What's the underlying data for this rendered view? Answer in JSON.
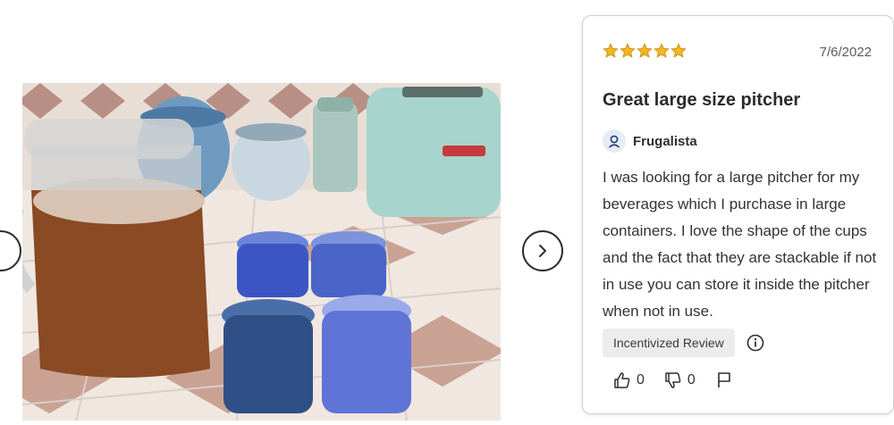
{
  "review": {
    "rating": 5,
    "date": "7/6/2022",
    "title": "Great large size pitcher",
    "author": "Frugalista",
    "body": "I was looking for a large pitcher for my beverages which I purchase in large containers. I love the shape of the cups and the fact that they are stackable if not in use you can store it inside the pitcher when not in use.",
    "badge": "Incentivized Review",
    "helpful_count": "0",
    "not_helpful_count": "0"
  },
  "icons": {
    "prev": "chevron-left-icon",
    "next": "chevron-right-icon",
    "star": "star-icon",
    "avatar": "user-icon",
    "info": "info-icon",
    "thumbs_up": "thumbs-up-icon",
    "thumbs_down": "thumbs-down-icon",
    "flag": "flag-icon"
  },
  "colors": {
    "star": "#f2b824",
    "star_outline": "#c98f12",
    "avatar_bg": "#e6ecf7",
    "avatar_fg": "#1f3a7a"
  }
}
